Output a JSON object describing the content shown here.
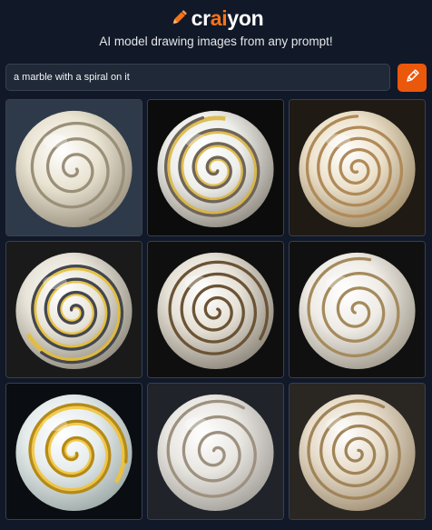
{
  "header": {
    "logo_parts": [
      "cr",
      "ai",
      "yon"
    ],
    "logo_icon": "pencil-icon",
    "tagline": "AI model drawing images from any prompt!"
  },
  "prompt": {
    "value": "a marble with a spiral on it",
    "button_icon": "pencil-icon"
  },
  "colors": {
    "background": "#111827",
    "accent": "#f97316",
    "button": "#ea580c"
  },
  "results": [
    {
      "label": "marble-image-1",
      "bg": "#2e3a4a",
      "base": "#e9e3d2",
      "rim": "#9c9380",
      "stroke": "#9a8f78",
      "turns": 3.2,
      "rot": 0,
      "accent": null
    },
    {
      "label": "marble-image-2",
      "bg": "#0c0c0c",
      "base": "#eeeeea",
      "rim": "#8f8a80",
      "stroke": "#6f6457",
      "turns": 3.6,
      "rot": 40,
      "accent": "#d9b43a"
    },
    {
      "label": "marble-image-3",
      "bg": "#201a14",
      "base": "#ece1cb",
      "rim": "#9f8c6a",
      "stroke": "#b08a58",
      "turns": 4.5,
      "rot": 90,
      "accent": null
    },
    {
      "label": "marble-image-4",
      "bg": "#1a1a1a",
      "base": "#e8e4d9",
      "rim": "#8f8a7d",
      "stroke": "#44474f",
      "turns": 3.8,
      "rot": 200,
      "accent": "#e6bd2e"
    },
    {
      "label": "marble-image-5",
      "bg": "#0f0f0f",
      "base": "#e6e1d6",
      "rim": "#8c857a",
      "stroke": "#6b5335",
      "turns": 4.2,
      "rot": 320,
      "accent": null
    },
    {
      "label": "marble-image-6",
      "bg": "#101010",
      "base": "#efece6",
      "rim": "#a19a8d",
      "stroke": "#a58a5c",
      "turns": 3.4,
      "rot": 140,
      "accent": null
    },
    {
      "label": "marble-image-7",
      "bg": "#0a0d12",
      "base": "#e6ecec",
      "rim": "#9ca9a7",
      "stroke": "#b58a18",
      "turns": 3.0,
      "rot": 10,
      "accent": "#f2c230"
    },
    {
      "label": "marble-image-8",
      "bg": "#20232a",
      "base": "#e9e7e2",
      "rim": "#a4a09a",
      "stroke": "#9d917f",
      "turns": 3.2,
      "rot": 230,
      "accent": null
    },
    {
      "label": "marble-image-9",
      "bg": "#2a2622",
      "base": "#e7dcca",
      "rim": "#a29176",
      "stroke": "#a08458",
      "turns": 4.0,
      "rot": 300,
      "accent": null
    }
  ]
}
